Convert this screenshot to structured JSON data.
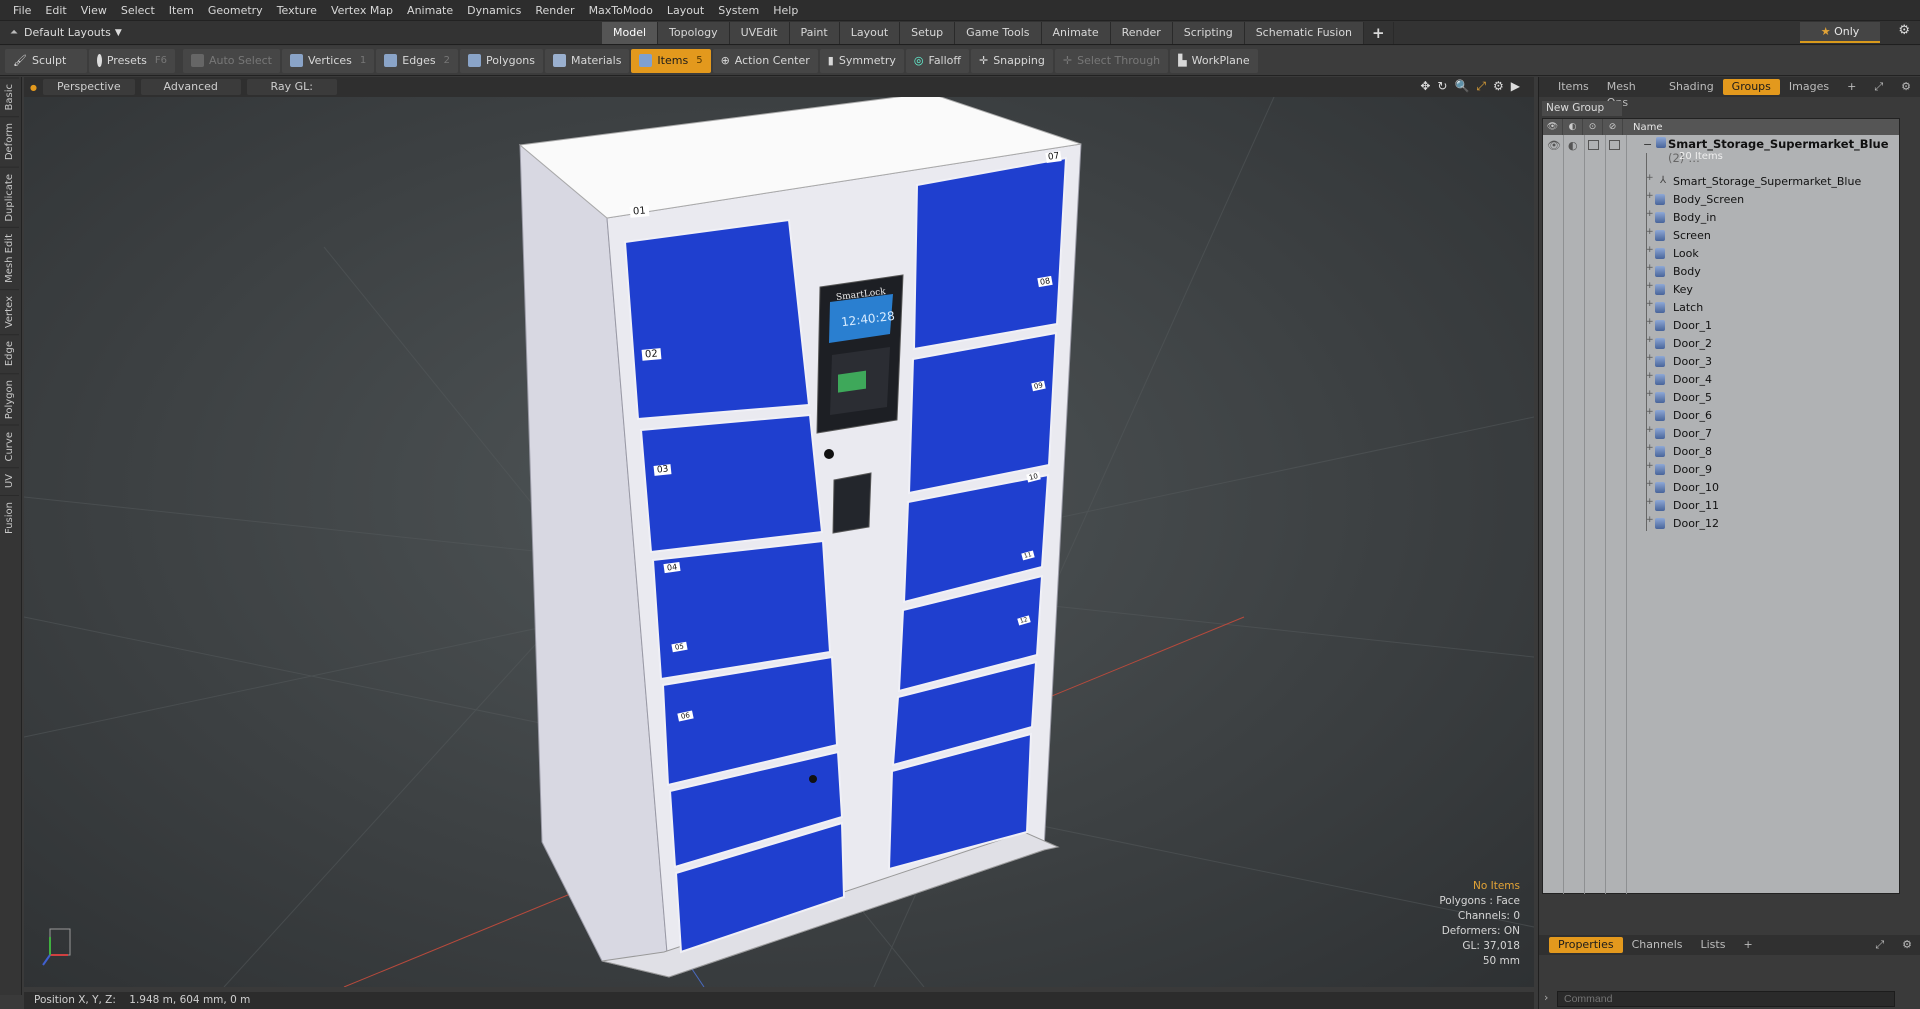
{
  "menu": [
    "File",
    "Edit",
    "View",
    "Select",
    "Item",
    "Geometry",
    "Texture",
    "Vertex Map",
    "Animate",
    "Dynamics",
    "Render",
    "MaxToModo",
    "Layout",
    "System",
    "Help"
  ],
  "layout_selector": "Default Layouts",
  "top_tabs": [
    "Model",
    "Topology",
    "UVEdit",
    "Paint",
    "Layout",
    "Setup",
    "Game Tools",
    "Animate",
    "Render",
    "Scripting",
    "Schematic Fusion"
  ],
  "active_top_tab": "Model",
  "only_label": "Only",
  "toolbar": {
    "sculpt": "Sculpt",
    "presets": "Presets",
    "presets_key": "F6",
    "auto_select": "Auto Select",
    "vertices": "Vertices",
    "vertices_key": "1",
    "edges": "Edges",
    "edges_key": "2",
    "polygons": "Polygons",
    "materials": "Materials",
    "items": "Items",
    "items_key": "5",
    "action_center": "Action Center",
    "symmetry": "Symmetry",
    "falloff": "Falloff",
    "snapping": "Snapping",
    "select_through": "Select Through",
    "workplane": "WorkPlane"
  },
  "left_tabs": [
    "Basic",
    "Deform",
    "Duplicate",
    "Mesh Edit",
    "Vertex",
    "Edge",
    "Polygon",
    "Curve",
    "UV",
    "Fusion"
  ],
  "viewport": {
    "perspective": "Perspective",
    "advanced": "Advanced",
    "raygl": "Ray GL: Off",
    "model_labels": {
      "brand": "SmartLock",
      "clock": "12:40:28",
      "doors_left": [
        "01",
        "02",
        "03",
        "04",
        "05",
        "06"
      ],
      "doors_right": [
        "07",
        "08",
        "09",
        "10",
        "11",
        "12"
      ]
    },
    "info": {
      "no_items": "No Items",
      "polygons": "Polygons : Face",
      "channels": "Channels: 0",
      "deformers": "Deformers: ON",
      "gl": "GL: 37,018",
      "size": "50 mm"
    }
  },
  "status": {
    "label": "Position X, Y, Z:",
    "value": "1.948 m, 604 mm, 0 m"
  },
  "right_panel": {
    "tabs": [
      "Items",
      "Mesh Ops",
      "Shading",
      "Groups",
      "Images"
    ],
    "active_tab": "Groups",
    "new_group": "New Group",
    "name_header": "Name",
    "group_name": "Smart_Storage_Supermarket_Blue",
    "group_count": "(2)",
    "group_sub": "20 Items",
    "items": [
      "Smart_Storage_Supermarket_Blue",
      "Body_Screen",
      "Body_in",
      "Screen",
      "Look",
      "Body",
      "Key",
      "Latch",
      "Door_1",
      "Door_2",
      "Door_3",
      "Door_4",
      "Door_5",
      "Door_6",
      "Door_7",
      "Door_8",
      "Door_9",
      "Door_10",
      "Door_11",
      "Door_12"
    ],
    "bottom_tabs": [
      "Properties",
      "Channels",
      "Lists"
    ],
    "active_bottom_tab": "Properties",
    "command_placeholder": "Command"
  },
  "colors": {
    "accent": "#e3991d",
    "door_blue": "#1f3fcf",
    "cabinet": "#e8e8ee"
  }
}
